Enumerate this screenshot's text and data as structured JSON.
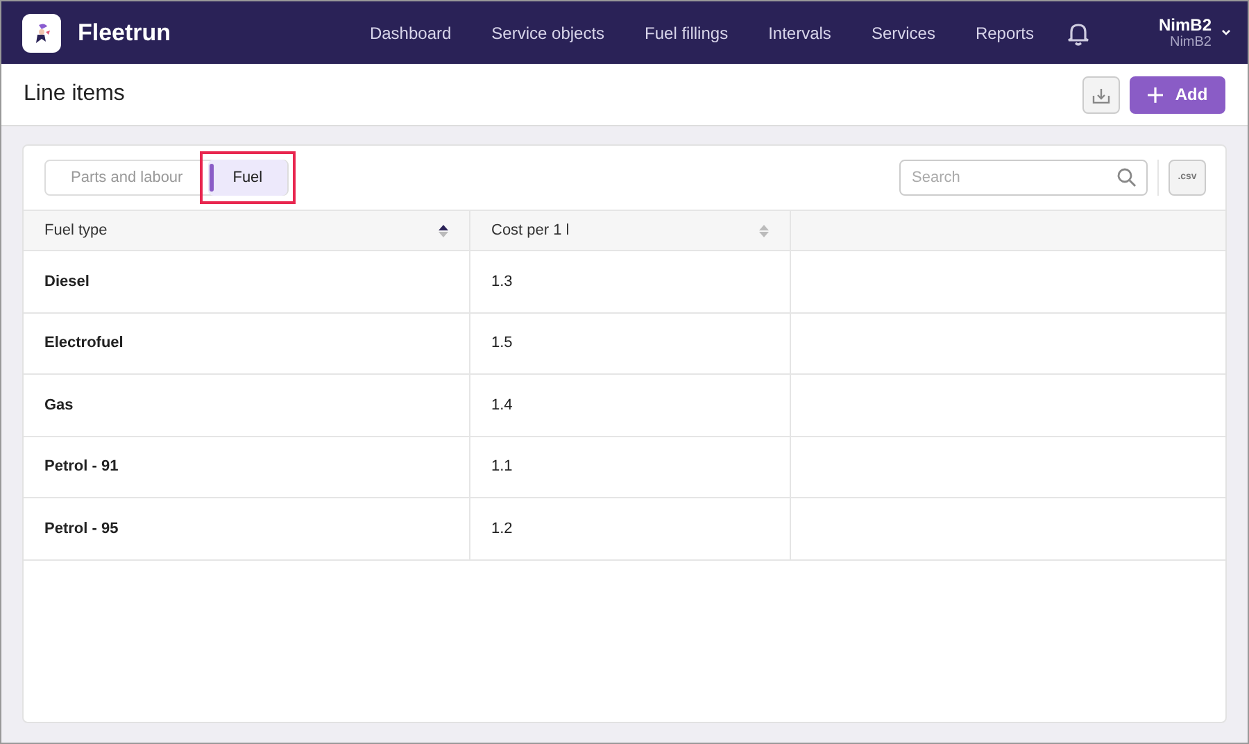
{
  "app": {
    "name": "Fleetrun"
  },
  "nav": [
    {
      "label": "Dashboard"
    },
    {
      "label": "Service objects"
    },
    {
      "label": "Fuel fillings"
    },
    {
      "label": "Intervals"
    },
    {
      "label": "Services"
    },
    {
      "label": "Reports"
    }
  ],
  "user": {
    "name": "NimB2",
    "account": "NimB2"
  },
  "page": {
    "title": "Line items",
    "add_button": "Add"
  },
  "tabs": [
    {
      "label": "Parts and labour",
      "selected": false
    },
    {
      "label": "Fuel",
      "selected": true
    }
  ],
  "search": {
    "placeholder": "Search"
  },
  "csv_button": ".csv",
  "table": {
    "columns": [
      {
        "label": "Fuel type",
        "sorted_ascending": true
      },
      {
        "label": "Cost per 1 l",
        "sorted_ascending": false
      }
    ],
    "rows": [
      [
        "Diesel",
        "1.3"
      ],
      [
        "Electrofuel",
        "1.5"
      ],
      [
        "Gas",
        "1.4"
      ],
      [
        "Petrol - 91",
        "1.1"
      ],
      [
        "Petrol - 95",
        "1.2"
      ]
    ]
  }
}
